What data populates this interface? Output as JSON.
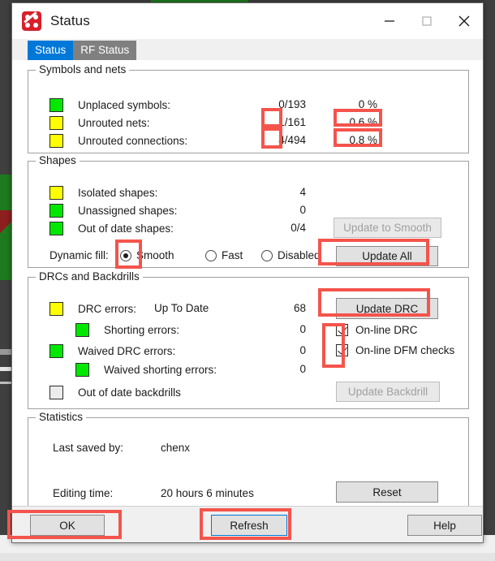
{
  "window": {
    "title": "Status",
    "icon": "pcb-status-icon",
    "minimize": "minimize-icon",
    "maximize": "maximize-icon",
    "close": "close-icon"
  },
  "tabs": [
    {
      "label": "Status",
      "active": true
    },
    {
      "label": "RF Status",
      "active": false
    }
  ],
  "groups": {
    "symbols_and_nets": {
      "legend": "Symbols and nets",
      "rows": [
        {
          "swatch": "green",
          "label": "Unplaced symbols:",
          "count": "0/193",
          "percent": "0 %"
        },
        {
          "swatch": "yellow",
          "label": "Unrouted nets:",
          "count": "1/161",
          "percent": "0.6 %"
        },
        {
          "swatch": "yellow",
          "label": "Unrouted connections:",
          "count": "4/494",
          "percent": "0.8 %"
        }
      ]
    },
    "shapes": {
      "legend": "Shapes",
      "rows": [
        {
          "swatch": "yellow",
          "label": "Isolated shapes:",
          "count": "4"
        },
        {
          "swatch": "green",
          "label": "Unassigned shapes:",
          "count": "0"
        },
        {
          "swatch": "green",
          "label": "Out of date shapes:",
          "count": "0/4"
        }
      ],
      "update_to_smooth_label": "Update to Smooth",
      "dynamic_fill_label": "Dynamic fill:",
      "dynamic_fill_options": [
        {
          "label": "Smooth",
          "selected": true
        },
        {
          "label": "Fast",
          "selected": false
        },
        {
          "label": "Disabled",
          "selected": false
        }
      ],
      "update_all_label": "Update All"
    },
    "drcs_and_backdrills": {
      "legend": "DRCs and Backdrills",
      "drc_errors": {
        "swatch": "yellow",
        "label": "DRC errors:",
        "status": "Up To Date",
        "count": "68"
      },
      "update_drc_label": "Update DRC",
      "shorting_errors": {
        "swatch": "green",
        "label": "Shorting errors:",
        "count": "0"
      },
      "waived_drc_errors": {
        "swatch": "green",
        "label": "Waived DRC errors:",
        "count": "0"
      },
      "waived_shorting_errors": {
        "swatch": "green",
        "label": "Waived shorting errors:",
        "count": "0"
      },
      "backdrills": {
        "label": "Out of date backdrills"
      },
      "update_backdrill_label": "Update Backdrill",
      "checkboxes": [
        {
          "label": "On-line DRC",
          "checked": true
        },
        {
          "label": "On-line DFM checks",
          "checked": true
        }
      ]
    },
    "statistics": {
      "legend": "Statistics",
      "last_saved_by_label": "Last saved by:",
      "last_saved_by_value": "chenx",
      "editing_time_label": "Editing time:",
      "editing_time_value": "20 hours 6 minutes",
      "reset_label": "Reset"
    }
  },
  "footer": {
    "ok_label": "OK",
    "refresh_label": "Refresh",
    "help_label": "Help"
  },
  "colors": {
    "green_swatch": "#00e800",
    "yellow_swatch": "#ffff00",
    "accent_tab": "#0078d7",
    "annotation": "#f4544c"
  }
}
